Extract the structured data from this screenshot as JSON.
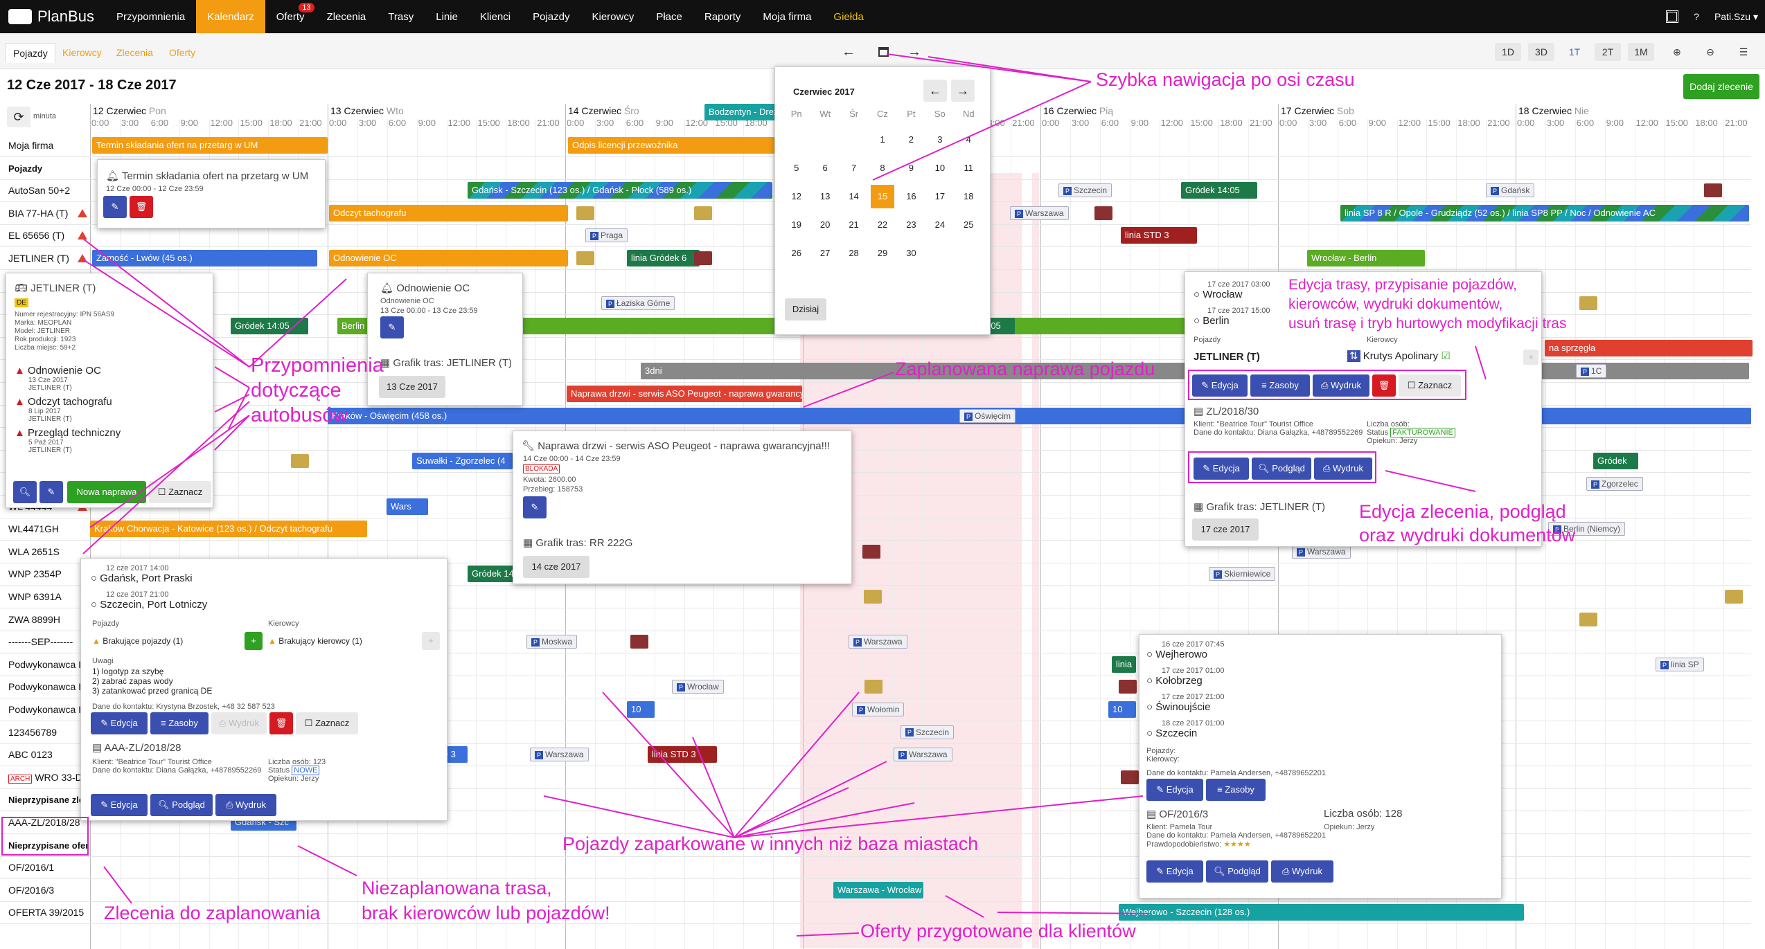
{
  "app": {
    "name": "PlanBus"
  },
  "nav": {
    "items": [
      {
        "label": "Przypomnienia"
      },
      {
        "label": "Kalendarz"
      },
      {
        "label": "Oferty",
        "badge": "13"
      },
      {
        "label": "Zlecenia"
      },
      {
        "label": "Trasy"
      },
      {
        "label": "Linie"
      },
      {
        "label": "Klienci"
      },
      {
        "label": "Pojazdy"
      },
      {
        "label": "Kierowcy"
      },
      {
        "label": "Płace"
      },
      {
        "label": "Raporty"
      },
      {
        "label": "Moja firma"
      },
      {
        "label": "Giełda"
      }
    ],
    "help": "?",
    "user": "Pati.Szu ▾"
  },
  "subtabs": [
    "Pojazdy",
    "Kierowcy",
    "Zlecenia",
    "Oferty"
  ],
  "toolbar": {
    "prev": "←",
    "next": "→",
    "zoom": [
      "1D",
      "3D",
      "1T",
      "2T",
      "1M"
    ]
  },
  "date_range": "12 Cze 2017 - 18 Cze 2017",
  "add_order": "Dodaj zlecenie",
  "timeline": {
    "minute_label": "minuta",
    "days": [
      {
        "date": "12 Czerwiec",
        "dow": "Pon"
      },
      {
        "date": "13 Czerwiec",
        "dow": "Wto"
      },
      {
        "date": "14 Czerwiec",
        "dow": "Śro"
      },
      {
        "date": "15 Czerwiec",
        "dow": "Czw"
      },
      {
        "date": "16 Czerwiec",
        "dow": "Pią"
      },
      {
        "date": "17 Czerwiec",
        "dow": "Sob"
      },
      {
        "date": "18 Czerwiec",
        "dow": "Nie"
      }
    ],
    "hours": [
      "0:00",
      "3:00",
      "6:00",
      "9:00",
      "12:00",
      "15:00",
      "18:00",
      "21:00"
    ]
  },
  "rows": [
    {
      "label": "Moja firma"
    },
    {
      "label": "Pojazdy",
      "bold": true
    },
    {
      "label": "AutoSan 50+2"
    },
    {
      "label": "BIA 77-HA (T)",
      "warn": true
    },
    {
      "label": "EL 65656 (T)",
      "warn": true
    },
    {
      "label": "JETLINER (T)",
      "warn": true
    },
    {
      "label": ""
    },
    {
      "label": ""
    },
    {
      "label": ""
    },
    {
      "label": ""
    },
    {
      "label": ""
    },
    {
      "label": ""
    },
    {
      "label": ""
    },
    {
      "label": ""
    },
    {
      "label": ""
    },
    {
      "label": ""
    },
    {
      "label": "WL 44444",
      "warn": true
    },
    {
      "label": "WL4471GH"
    },
    {
      "label": "WLA 2651S"
    },
    {
      "label": "WNP 2354P"
    },
    {
      "label": "WNP 6391A"
    },
    {
      "label": "ZWA 8899H"
    },
    {
      "label": "-------SEP-------"
    },
    {
      "label": "Podwykonawca I"
    },
    {
      "label": "Podwykonawca II"
    },
    {
      "label": "Podwykonawca III"
    },
    {
      "label": "123456789"
    },
    {
      "label": "ABC 0123"
    },
    {
      "label": "WRO 33-D",
      "arch": "ARCH"
    },
    {
      "label": "Nieprzypisane zlec",
      "bold": true
    },
    {
      "label": "AAA-ZL/2018/28"
    },
    {
      "label": "Nieprzypisane oferty",
      "bold": true
    },
    {
      "label": "OF/2016/1"
    },
    {
      "label": "OF/2016/3"
    },
    {
      "label": "OFERTA 39/2015"
    }
  ],
  "bars": [
    "Termin składania ofert na przetarg w UM",
    "Odpis licencji przewoźnika",
    "Gdańsk - Szczecin (123 os.) / Gdańsk - Płock (589 os.)",
    "Szczecin",
    "Gródek 14:05",
    "Gdańsk",
    "Odczyt tachografu",
    "Warszawa",
    "linia SP 8 R / Opole - Grudziądz (52 os.) / linia SP8 PP / Noc / Odnowienie AC",
    "Praga",
    "linia STD 3",
    "Zamość - Lwów (45 os.)",
    "Odnowienie OC",
    "linia Gródek 6",
    "Wrocław - Berlin",
    "Łaziska Górne",
    "Gródek 14:05",
    "Berlin",
    "linia Gródek 6",
    "Gródek 14:05",
    "na sprzęgła",
    "3dni",
    "Naprawa drzwi - serwis ASO Peugeot - naprawa gwarancyjna",
    "Kraków - Oświęcim (458 os.)",
    "Oświęcim",
    "Suwałki - Zgorzelec (4",
    "Gródek",
    "Zgorzelec",
    "Wars",
    "Kraków Chorwacja - Katowice (123 os.) / Odczyt tachografu",
    "Warszawa",
    "linia Gródek 6",
    "Berlin (Niemcy)",
    "Gródek 14:05",
    "Warszawa",
    "linia SP",
    "Skierniewice",
    "Moskwa",
    "Warszawa",
    "linia",
    "linia SP",
    "Wrocław",
    "Wołomin",
    "Szczecin",
    "Warszawa",
    "Warszawa",
    "linia STD 3",
    "STD 3",
    "Gdańsk - Szc",
    "Warszawa - Wrocław",
    "Wejherowo - Szczecin (128 os.)",
    "Bodzentyn - Drezder",
    "1C",
    "10",
    "10"
  ],
  "popup_reminder": {
    "title": "Termin składania ofert na przetarg w UM",
    "dates": "12 Cze 00:00 - 12 Cze 23:59"
  },
  "popup_vehicle": {
    "title": "JETLINER (T)",
    "country": "DE",
    "details": [
      "Numer rejestracyjny: IPN 56AS9",
      "Marka: MEOPLAN",
      "Model: JETLINER",
      "Rok produkcji: 1923",
      "Liczba miejsc: 59+2"
    ],
    "reminders": [
      {
        "title": "Odnowienie OC",
        "date": "13 Cze 2017",
        "veh": "JETLINER (T)"
      },
      {
        "title": "Odczyt tachografu",
        "date": "8 Lip 2017",
        "veh": "JETLINER (T)"
      },
      {
        "title": "Przegląd techniczny",
        "date": "5 Paź 2017",
        "veh": "JETLINER (T)"
      }
    ],
    "new_repair": "Nowa naprawa",
    "select": "Zaznacz"
  },
  "popup_oc": {
    "title": "Odnowienie OC",
    "sub1": "Odnowienie OC",
    "dates": "13 Cze 00:00 - 13 Cze 23:59",
    "schedule": "Grafik tras: JETLINER (T)",
    "date_btn": "13 Cze 2017"
  },
  "popup_repair": {
    "title": "Naprawa drzwi - serwis ASO Peugeot - naprawa gwarancyjna!!!",
    "dates": "14 Cze 00:00 - 14 Cze 23:59",
    "status": "BLOKADA",
    "amount": "Kwota: 2600.00",
    "mileage": "Przebieg: 158753",
    "schedule": "Grafik tras: RR 222G",
    "date_btn": "14 cze 2017"
  },
  "popup_route": {
    "from_time": "12 cze 2017 14:00",
    "from": "Gdańsk, Port Praski",
    "to_time": "12 cze 2017 21:00",
    "to": "Szczecin, Port Lotniczy",
    "vehicles_lbl": "Pojazdy",
    "drivers_lbl": "Kierowcy",
    "missing_veh": "Brakujące pojazdy (1)",
    "missing_drv": "Brakujący kierowcy (1)",
    "notes_lbl": "Uwagi",
    "notes": [
      "1) logotyp za szybę",
      "2) zabrać zapas wody",
      "3) zatankować przed granicą DE"
    ],
    "contact": "Dane do kontaktu: Krystyna Brzostek, +48 32 587 523",
    "btn_edit": "Edycja",
    "btn_res": "Zasoby",
    "btn_print": "Wydruk",
    "btn_select": "Zaznacz",
    "order_no": "AAA-ZL/2018/28",
    "client": "Klient: \"Beatrice Tour\" Tourist Office",
    "client_contact": "Dane do kontaktu: Diana Gałązka, +48789552269",
    "persons": "Liczba osób: 123",
    "status_lbl": "Status",
    "status": "NOWE",
    "guardian": "Opiekun: Jerzy",
    "btn_preview": "Podgląd"
  },
  "calendar": {
    "month": "Czerwiec 2017",
    "dows": [
      "Pn",
      "Wt",
      "Śr",
      "Cz",
      "Pt",
      "So",
      "Nd"
    ],
    "weeks": [
      [
        "",
        "",
        "",
        "1",
        "2",
        "3",
        "4"
      ],
      [
        "5",
        "6",
        "7",
        "8",
        "9",
        "10",
        "11"
      ],
      [
        "12",
        "13",
        "14",
        "15",
        "16",
        "17",
        "18"
      ],
      [
        "19",
        "20",
        "21",
        "22",
        "23",
        "24",
        "25"
      ],
      [
        "26",
        "27",
        "28",
        "29",
        "30",
        "",
        ""
      ]
    ],
    "today_btn": "Dzisiaj",
    "selected": "15"
  },
  "popup_trip": {
    "from_time": "17 cze 2017 03:00",
    "from": "Wrocław",
    "to_time": "17 cze 2017 15:00",
    "to": "Berlin",
    "vehicles_lbl": "Pojazdy",
    "drivers_lbl": "Kierowcy",
    "vehicle": "JETLINER (T)",
    "driver": "Krutys Apolinary",
    "btn_edit": "Edycja",
    "btn_res": "Zasoby",
    "btn_print": "Wydruk",
    "btn_select": "Zaznacz",
    "order_no": "ZL/2018/30",
    "client": "Klient: \"Beatrice Tour\" Tourist Office",
    "client_contact": "Dane do kontaktu: Diana Gałązka, +48789552269",
    "persons": "Liczba osób:",
    "status_lbl": "Status",
    "status": "FAKTUROWANIE",
    "guardian": "Opiekun: Jerzy",
    "btn_preview": "Podgląd",
    "schedule": "Grafik tras: JETLINER (T)",
    "date_btn": "17 cze 2017"
  },
  "popup_offer": {
    "stops": [
      {
        "time": "16 cze 2017 07:45",
        "name": "Wejherowo"
      },
      {
        "time": "17 cze 2017 01:00",
        "name": "Kołobrzeg"
      },
      {
        "time": "17 cze 2017 21:00",
        "name": "Świnoujście"
      },
      {
        "time": "18 cze 2017 01:00",
        "name": "Szczecin"
      }
    ],
    "vehicles_lbl": "Pojazdy:",
    "drivers_lbl": "Kierowcy:",
    "contact": "Dane do kontaktu: Pamela Andersen, +48789652201",
    "btn_edit": "Edycja",
    "btn_res": "Zasoby",
    "offer_no": "OF/2016/3",
    "persons": "Liczba osób: 128",
    "client": "Klient: Pamela Tour",
    "client_contact": "Dane do kontaktu: Pamela Andersen, +48789652201",
    "guardian": "Opiekun: Jerzy",
    "probability": "Prawdopodobieństwo:",
    "btn_preview": "Podgląd",
    "btn_print": "Wydruk"
  },
  "annotations": {
    "timeline_nav": "Szybka nawigacja po osi czasu",
    "reminders": [
      "Przypomnienia",
      "dotyczące",
      "autobusów"
    ],
    "repair": "Zaplanowana naprawa pojazdu",
    "route_edit": [
      "Edycja trasy, przypisanie pojazdów,",
      "kierowców, wydruki dokumentów,",
      "usuń trasę i tryb hurtowych modyfikacji tras"
    ],
    "order_edit": [
      "Edycja zlecenia, podgląd",
      "oraz wydruki dokumentów"
    ],
    "parked": "Pojazdy zaparkowane w innych niż baza miastach",
    "unplanned": [
      "Niezaplanowana trasa,",
      "brak kierowców lub pojazdów!"
    ],
    "to_plan": "Zlecenia do zaplanowania",
    "offers": "Oferty przygotowane dla klientów"
  },
  "colors": {
    "accent": "#f39c12",
    "annotation": "#e020c8",
    "primary_btn": "#3a4faf",
    "success": "#2ea022",
    "danger": "#d71921"
  }
}
